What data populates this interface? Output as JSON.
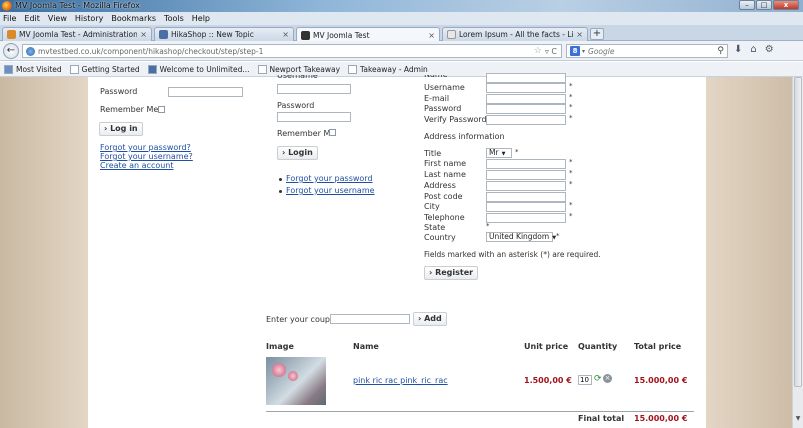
{
  "window": {
    "title": "MV Joomla Test - Mozilla Firefox",
    "buttons": [
      "–",
      "□",
      "x"
    ]
  },
  "menu": [
    "File",
    "Edit",
    "View",
    "History",
    "Bookmarks",
    "Tools",
    "Help"
  ],
  "tabs": [
    {
      "label": "MV Joomla Test - Administration - Z...",
      "close": "×",
      "color": "#d98a2a"
    },
    {
      "label": "HikaShop :: New Topic",
      "close": "×",
      "color": "#4a6fa5"
    },
    {
      "label": "MV Joomla Test",
      "close": "×",
      "color": "#333333",
      "active": true
    },
    {
      "label": "Lorem Ipsum - All the facts - Lipsum ...",
      "close": "×",
      "color": "#e8e8e8"
    }
  ],
  "new_tab": "+",
  "nav": {
    "back": "←",
    "url": "mvtestbed.co.uk/component/hikashop/checkout/step/step-1",
    "star": "☆",
    "reload": "▿ C",
    "search_engine": "8",
    "search_arrow": "▾",
    "search_placeholder": "Google",
    "search_icon": "⚲",
    "download_icon": "⬇",
    "home_icon": "⌂",
    "addon_icon": "⚙"
  },
  "bookmarks": [
    "Most Visited",
    "Getting Started",
    "Welcome to Unlimited...",
    "Newport Takeaway",
    "Takeaway - Admin"
  ],
  "login_left": {
    "password_label": "Password",
    "remember_label": "Remember Me",
    "login_button": "› Log in",
    "forgot_password": "Forgot your password?",
    "forgot_username": "Forgot your username?",
    "create_account": "Create an account"
  },
  "login_mid": {
    "username_label": "Username",
    "password_label": "Password",
    "remember_label": "Remember Me",
    "login_button": "› Login",
    "forgot_password": "Forgot your password",
    "forgot_username": "Forgot your username"
  },
  "register": {
    "name_label": "Name",
    "username_label": "Username",
    "email_label": "E-mail",
    "password_label": "Password",
    "verify_label": "Verify Password",
    "address_heading": "Address information",
    "title_label": "Title",
    "title_value": "Mr",
    "firstname_label": "First name",
    "lastname_label": "Last name",
    "address_label": "Address",
    "postcode_label": "Post code",
    "city_label": "City",
    "telephone_label": "Telephone",
    "state_label": "State",
    "country_label": "Country",
    "country_value": "United Kingdom",
    "asterisk": "*",
    "required_note": "Fields marked with an asterisk (*) are required.",
    "register_button": "› Register"
  },
  "coupon": {
    "label": "Enter your coupon",
    "button": "› Add"
  },
  "cart": {
    "headers": {
      "image": "Image",
      "name": "Name",
      "unit_price": "Unit price",
      "quantity": "Quantity",
      "total_price": "Total price"
    },
    "row": {
      "name": "pink ric rac pink_ric_rac",
      "unit_price": "1.500,00 €",
      "quantity": "10",
      "total": "15.000,00 €"
    },
    "final_label": "Final total",
    "final_value": "15.000,00 €"
  }
}
